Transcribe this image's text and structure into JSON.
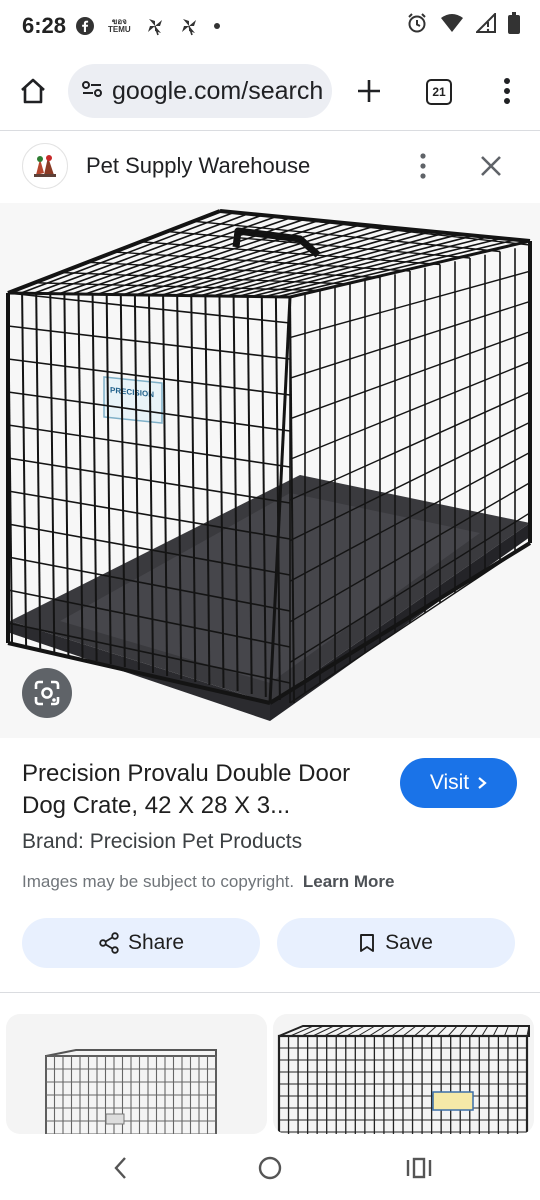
{
  "status_bar": {
    "time": "6:28",
    "temu_label_top": "ขอจ",
    "temu_label_bottom": "TEMU",
    "icons": [
      "facebook-icon",
      "temu-icon",
      "pinwheel-icon",
      "pinwheel-icon",
      "dot-icon",
      "alarm-icon",
      "wifi-icon",
      "signal-icon",
      "battery-icon"
    ]
  },
  "browser": {
    "url": "google.com/search",
    "tab_count": "21"
  },
  "panel": {
    "site_name": "Pet Supply Warehouse"
  },
  "product": {
    "title": "Precision Provalu Double Door Dog Crate, 42 X 28 X 3...",
    "visit_label": "Visit",
    "brand": "Brand: Precision Pet Products",
    "copyright": "Images may be subject to copyright.",
    "learn_more": "Learn More",
    "share_label": "Share",
    "save_label": "Save",
    "crate_tag_text": "PRECISION"
  },
  "colors": {
    "accent": "#1a73e8",
    "chip_bg": "#e8f0fe",
    "url_bg": "#eceef3",
    "lens_bg": "#5f6368"
  }
}
